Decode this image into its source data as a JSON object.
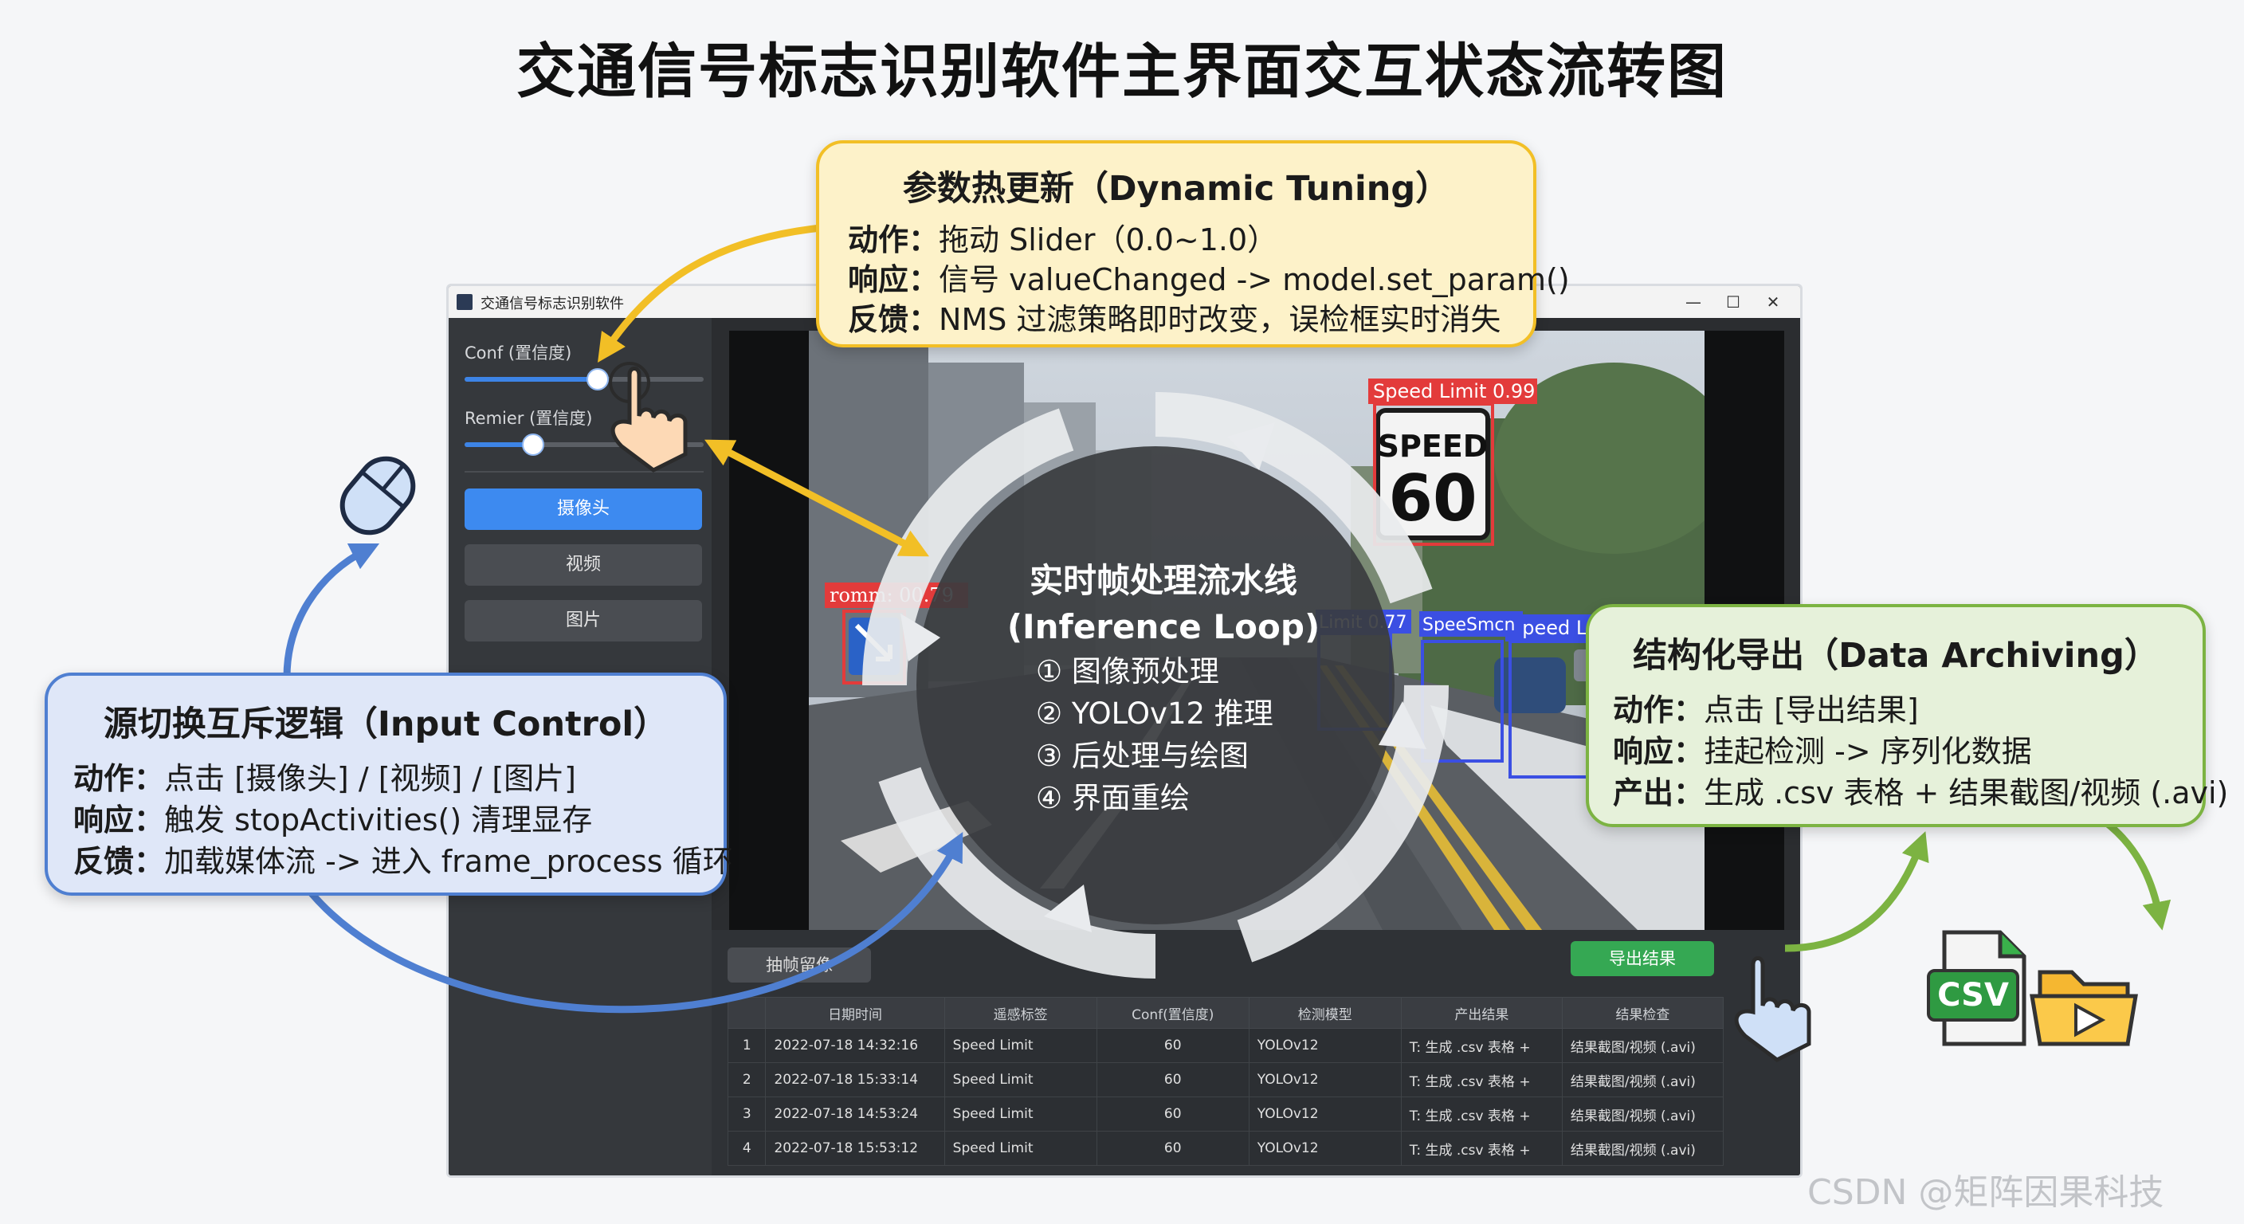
{
  "title": "交通信号标志识别软件主界面交互状态流转图",
  "window": {
    "title": "交通信号标志识别软件",
    "controls": [
      "—",
      "☐",
      "✕"
    ]
  },
  "sidebar": {
    "conf_label": "Conf (置信度)",
    "conf_value": 0.55,
    "remier_label": "Remier (置信度)",
    "remier_value": 0.28,
    "buttons": [
      "摄像头",
      "视频",
      "图片"
    ],
    "active_button": "摄像头"
  },
  "detections": [
    {
      "label": "Speed Limit 0.99",
      "color": "#e33b3b"
    },
    {
      "label": "romm: 00.79",
      "color": "#e33b3b"
    },
    {
      "label": "Speed Limit 0.87",
      "color": "#3b4fe3"
    },
    {
      "label": "SpeeSmcn",
      "color": "#3b4fe3"
    },
    {
      "label": "Limit 0.77",
      "color": "#3b4fe3"
    }
  ],
  "sign": {
    "top": "SPEED",
    "number": "60"
  },
  "bottom": {
    "capture_label": "抽帧留像",
    "export_label": "导出结果",
    "columns": [
      "",
      "日期时间",
      "遥感标签",
      "Conf(置信度)",
      "检测模型",
      "产出结果",
      "结果检查"
    ],
    "rows": [
      [
        "1",
        "2022-07-18 14:32:16",
        "Speed Limit",
        "60",
        "YOLOv12",
        "T: 生成 .csv 表格 +",
        "结果截图/视频 (.avi)"
      ],
      [
        "2",
        "2022-07-18 15:33:14",
        "Speed Limit",
        "60",
        "YOLOv12",
        "T: 生成 .csv 表格 +",
        "结果截图/视频 (.avi)"
      ],
      [
        "3",
        "2022-07-18 14:53:24",
        "Speed Limit",
        "60",
        "YOLOv12",
        "T: 生成 .csv 表格 +",
        "结果截图/视频 (.avi)"
      ],
      [
        "4",
        "2022-07-18 15:53:12",
        "Speed Limit",
        "60",
        "YOLOv12",
        "T: 生成 .csv 表格 +",
        "结果截图/视频 (.avi)"
      ]
    ]
  },
  "tuning": {
    "title": "参数热更新（Dynamic Tuning）",
    "action_key": "动作：",
    "action": "拖动 Slider（0.0~1.0）",
    "response_key": "响应：",
    "response": "信号 valueChanged -> model.set_param()",
    "feedback_key": "反馈：",
    "feedback": "NMS 过滤策略即时改变，误检框实时消失"
  },
  "input_control": {
    "title": "源切换互斥逻辑（Input Control）",
    "action_key": "动作：",
    "action": "点击 [摄像头] / [视频] / [图片]",
    "response_key": "响应：",
    "response": "触发 stopActivities() 清理显存",
    "feedback_key": "反馈：",
    "feedback": "加载媒体流 -> 进入 frame_process 循环"
  },
  "archiving": {
    "title": "结构化导出（Data Archiving）",
    "action_key": "动作：",
    "action": "点击 [导出结果]",
    "response_key": "响应：",
    "response": "挂起检测 -> 序列化数据",
    "output_key": "产出：",
    "output": "生成 .csv 表格 + 结果截图/视频 (.avi)"
  },
  "loop": {
    "title_cn": "实时帧处理流水线",
    "title_en": "(Inference Loop)",
    "steps": [
      "① 图像预处理",
      "② YOLOv12 推理",
      "③ 后处理与绘图",
      "④ 界面重绘"
    ]
  },
  "csv_label": "CSV",
  "watermark": "CSDN @矩阵因果科技",
  "colors": {
    "tuning": "#f2bf26",
    "input": "#4f7fd1",
    "archive": "#7cb342",
    "accent": "#3d8af0"
  }
}
